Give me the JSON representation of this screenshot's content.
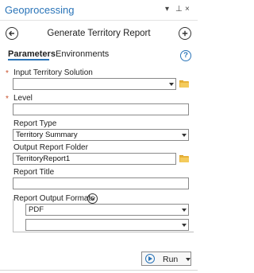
{
  "pane": {
    "title": "Geoprocessing",
    "pin_glyph": "▾ ⊥ ×"
  },
  "tool": {
    "title": "Generate Territory Report",
    "back_icon": "arrow-left-circle",
    "add_icon": "plus-circle"
  },
  "tabs": [
    {
      "label": "Parameters",
      "active": true
    },
    {
      "label": "Environments",
      "active": false
    }
  ],
  "help_glyph": "?",
  "fields": {
    "input_territory_solution": {
      "label": "Input Territory Solution",
      "value": "",
      "required": true
    },
    "level": {
      "label": "Level",
      "value": "",
      "required": true
    },
    "report_type": {
      "label": "Report Type",
      "value": "Territory Summary"
    },
    "output_report_folder": {
      "label": "Output Report Folder",
      "value": "TerritoryReport1"
    },
    "report_title": {
      "label": "Report Title",
      "value": ""
    },
    "report_output_formats": {
      "label": "Report Output Formats",
      "values": [
        "PDF",
        ""
      ]
    }
  },
  "required_mark": "*",
  "run": {
    "label": "Run"
  },
  "colors": {
    "accent": "#2a74b8",
    "required": "#c8502a",
    "folder": "#e8b33a"
  }
}
